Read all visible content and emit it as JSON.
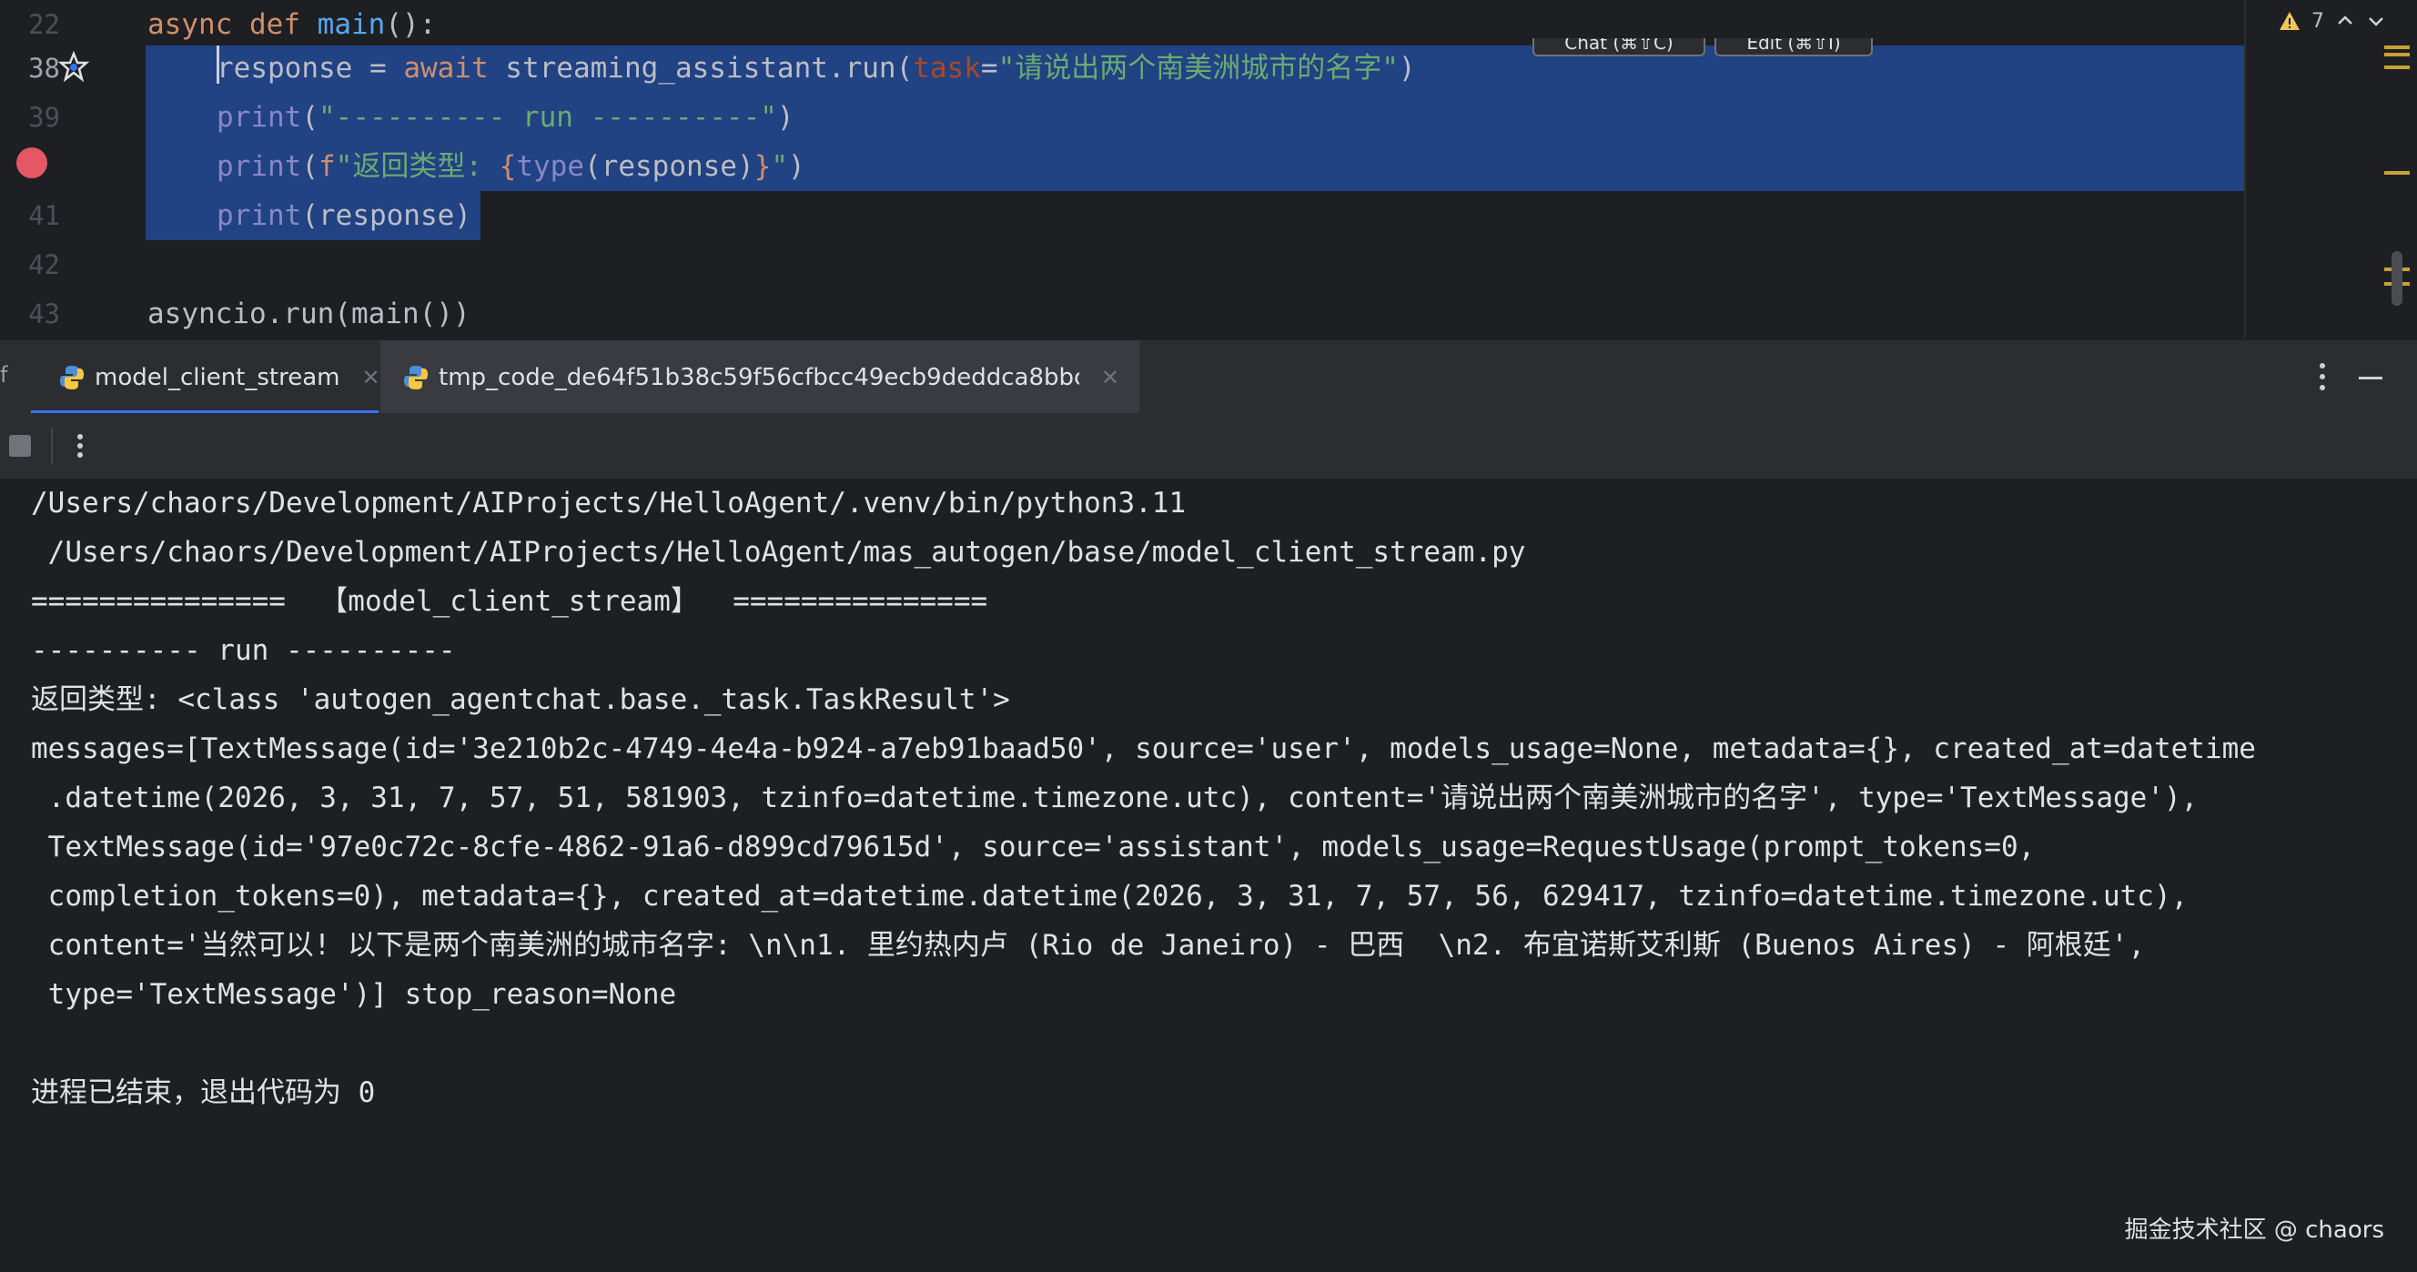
{
  "editor": {
    "line_numbers": [
      "22",
      "38",
      "39",
      "41",
      "42",
      "43"
    ],
    "lines": {
      "l22": {
        "kw1": "async",
        "kw2": "def",
        "fn": "main",
        "rest": "():"
      },
      "l38": {
        "var": "response = ",
        "kw": "await",
        "call": " streaming_assistant.run(",
        "param": "task",
        "eq": "=",
        "str": "\"请说出两个南美洲城市的名字\"",
        "close": ")"
      },
      "l39": {
        "fn": "print",
        "open": "(",
        "str": "\"---------- run ----------\"",
        "close": ")"
      },
      "l40": {
        "fn": "print",
        "open": "(",
        "prefix": "f",
        "str1": "\"返回类型: ",
        "brace1": "{",
        "builtin": "type",
        "mid": "(response)",
        "brace2": "}",
        "str2": "\"",
        "close": ")"
      },
      "l41": {
        "fn": "print",
        "rest": "(response)"
      },
      "l43": {
        "text": "asyncio.run(main())"
      }
    },
    "inlay_buttons": [
      "Chat (⌘⇧C)",
      "Edit (⌘⇧I)"
    ],
    "warnings_count": "7"
  },
  "tabs": [
    {
      "label": "model_client_stream",
      "icon": "python-icon",
      "active": true
    },
    {
      "label": "tmp_code_de64f51b38c59f56cfbcc49ecb9deddca8bbc...",
      "icon": "python-icon",
      "active": false
    }
  ],
  "tab_edge_char": "f",
  "console": {
    "lines": [
      "/Users/chaors/Development/AIProjects/HelloAgent/.venv/bin/python3.11",
      " /Users/chaors/Development/AIProjects/HelloAgent/mas_autogen/base/model_client_stream.py",
      "===============  【model_client_stream】  ===============",
      "---------- run ----------",
      "返回类型: <class 'autogen_agentchat.base._task.TaskResult'>",
      "messages=[TextMessage(id='3e210b2c-4749-4e4a-b924-a7eb91baad50', source='user', models_usage=None, metadata={}, created_at=datetime",
      " .datetime(2026, 3, 31, 7, 57, 51, 581903, tzinfo=datetime.timezone.utc), content='请说出两个南美洲城市的名字', type='TextMessage'),",
      " TextMessage(id='97e0c72c-8cfe-4862-91a6-d899cd79615d', source='assistant', models_usage=RequestUsage(prompt_tokens=0,",
      " completion_tokens=0), metadata={}, created_at=datetime.datetime(2026, 3, 31, 7, 57, 56, 629417, tzinfo=datetime.timezone.utc),",
      " content='当然可以! 以下是两个南美洲的城市名字: \\n\\n1. 里约热内卢 (Rio de Janeiro) - 巴西  \\n2. 布宜诺斯艾利斯 (Buenos Aires) - 阿根廷',",
      " type='TextMessage')] stop_reason=None",
      "",
      "进程已结束，退出代码为 0"
    ]
  },
  "watermark": "掘金技术社区 @ chaors",
  "colors": {
    "background": "#1e1f22",
    "panel": "#2b2d30",
    "selection": "#214283",
    "keyword": "#cf8e6d",
    "function": "#56a8f5",
    "string": "#6aab73",
    "breakpoint": "#e55765",
    "accent": "#3574f0"
  }
}
